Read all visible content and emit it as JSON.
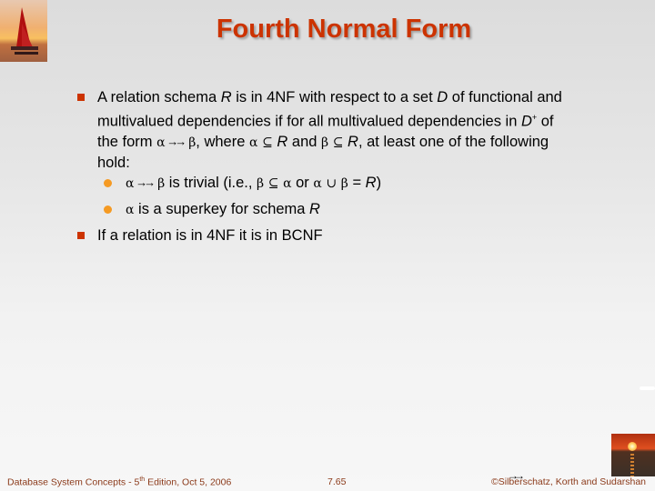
{
  "slide": {
    "title": "Fourth Normal Form",
    "bullets": [
      {
        "level": 1,
        "lines": [
          [
            "A relation schema ",
            {
              "i": "R"
            },
            " is in 4NF with respect to a set ",
            {
              "i": "D"
            },
            " of functional and"
          ],
          [
            "multivalued dependencies if for all multivalued dependencies in ",
            {
              "i": "D"
            },
            {
              "sup": "+"
            },
            " of"
          ],
          [
            "the form ",
            {
              "sym": "α"
            },
            {
              "mvd": "→→"
            },
            {
              "sym": "β"
            },
            ", where ",
            {
              "sym": "α"
            },
            " ",
            {
              "sym": "⊆"
            },
            " ",
            {
              "i": "R"
            },
            " and ",
            {
              "sym": "β"
            },
            " ",
            {
              "sym": "⊆"
            },
            " ",
            {
              "i": "R"
            },
            ", at least one of the following"
          ],
          [
            "hold:"
          ]
        ]
      },
      {
        "level": 2,
        "lines": [
          [
            {
              "sym": "α"
            },
            {
              "mvd": "→→"
            },
            {
              "sym": "β"
            },
            " is trivial (i.e., ",
            {
              "sym": "β"
            },
            " ",
            {
              "sym": "⊆"
            },
            " ",
            {
              "sym": "α"
            },
            " or ",
            {
              "sym": "α"
            },
            " ",
            {
              "sym": "∪"
            },
            " ",
            {
              "sym": "β"
            },
            " = ",
            {
              "i": "R"
            },
            ")"
          ]
        ]
      },
      {
        "level": 2,
        "lines": [
          [
            {
              "sym": "α"
            },
            " is a superkey for schema ",
            {
              "i": "R"
            }
          ]
        ]
      },
      {
        "level": 1,
        "lines": [
          [
            "If a relation is in 4NF it is in BCNF"
          ]
        ]
      }
    ]
  },
  "footer": {
    "left_pre": "Database System Concepts - 5",
    "left_sup": "th",
    "left_post": " Edition, Oct 5, 2006",
    "center": "7.65",
    "right": "©Silberschatz, Korth and Sudarshan"
  },
  "decor": {
    "top_left_image": "sailboat-sunset-image",
    "bottom_right_image": "sunset-image",
    "stray_arrow": "→→"
  },
  "colors": {
    "title": "#cc3300",
    "level1_bullet": "#cc3300",
    "level2_bullet": "#f59a23",
    "footer_text": "#8b3a1a"
  }
}
